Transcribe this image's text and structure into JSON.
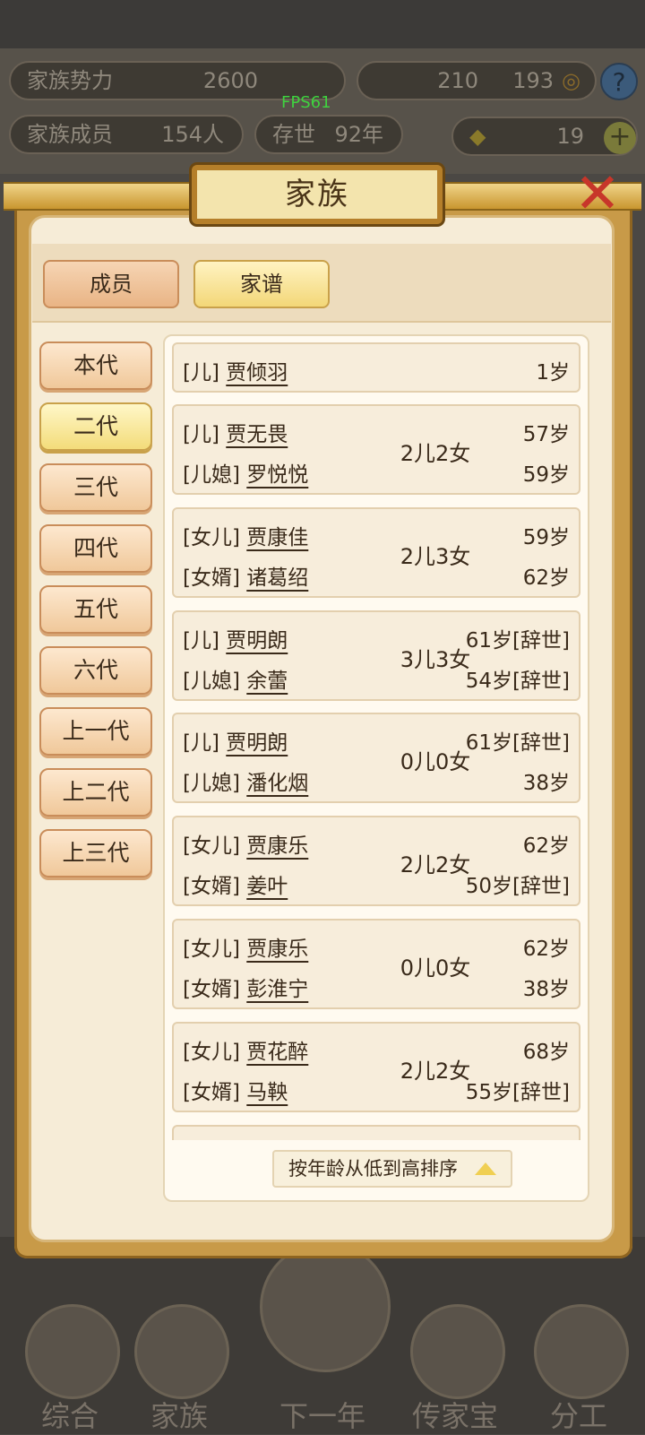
{
  "hud": {
    "power_label": "家族势力",
    "power_value": "2600",
    "resource_a": "210",
    "resource_b": "193",
    "members_label": "家族成员",
    "members_value": "154人",
    "years_label": "存世",
    "years_value": "92年",
    "gold_value": "19",
    "fps": "FPS61",
    "help": "?",
    "plus": "+"
  },
  "dialog": {
    "title": "家族",
    "close": "✕",
    "tabs": [
      {
        "label": "成员",
        "active": false
      },
      {
        "label": "家谱",
        "active": true
      }
    ],
    "generations": [
      {
        "label": "本代",
        "active": false
      },
      {
        "label": "二代",
        "active": true
      },
      {
        "label": "三代",
        "active": false
      },
      {
        "label": "四代",
        "active": false
      },
      {
        "label": "五代",
        "active": false
      },
      {
        "label": "六代",
        "active": false
      },
      {
        "label": "上一代",
        "active": false
      },
      {
        "label": "上二代",
        "active": false
      },
      {
        "label": "上三代",
        "active": false
      }
    ],
    "records": [
      {
        "role1": "[儿]",
        "name1": "贾倾羽",
        "age1": "1岁"
      },
      {
        "role1": "[儿]",
        "name1": "贾无畏",
        "age1": "57岁",
        "role2": "[儿媳]",
        "name2": "罗悦悦",
        "age2": "59岁",
        "kids": "2儿2女"
      },
      {
        "role1": "[女儿]",
        "name1": "贾康佳",
        "age1": "59岁",
        "role2": "[女婿]",
        "name2": "诸葛绍",
        "age2": "62岁",
        "kids": "2儿3女"
      },
      {
        "role1": "[儿]",
        "name1": "贾明朗",
        "age1": "61岁[辞世]",
        "role2": "[儿媳]",
        "name2": "余蕾",
        "age2": "54岁[辞世]",
        "kids": "3儿3女"
      },
      {
        "role1": "[儿]",
        "name1": "贾明朗",
        "age1": "61岁[辞世]",
        "role2": "[儿媳]",
        "name2": "潘化烟",
        "age2": "38岁",
        "kids": "0儿0女"
      },
      {
        "role1": "[女儿]",
        "name1": "贾康乐",
        "age1": "62岁",
        "role2": "[女婿]",
        "name2": "姜叶",
        "age2": "50岁[辞世]",
        "kids": "2儿2女"
      },
      {
        "role1": "[女儿]",
        "name1": "贾康乐",
        "age1": "62岁",
        "role2": "[女婿]",
        "name2": "彭淮宁",
        "age2": "38岁",
        "kids": "0儿0女"
      },
      {
        "role1": "[女儿]",
        "name1": "贾花醉",
        "age1": "68岁",
        "role2": "[女婿]",
        "name2": "马鞅",
        "age2": "55岁[辞世]",
        "kids": "2儿2女"
      }
    ],
    "sort_label": "按年龄从低到高排序"
  },
  "bottom_nav": [
    {
      "label": "综合"
    },
    {
      "label": "家族"
    },
    {
      "label": "下一年"
    },
    {
      "label": "传家宝"
    },
    {
      "label": "分工"
    }
  ]
}
